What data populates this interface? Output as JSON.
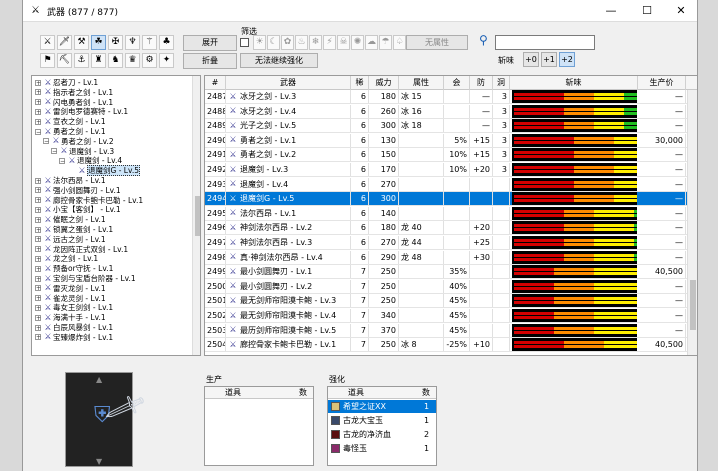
{
  "window": {
    "title": "武器 (877 / 877)",
    "minimize": "—",
    "maximize": "☐",
    "close": "✕"
  },
  "toolbar": {
    "expand_label": "展开",
    "collapse_label": "折叠",
    "filter_label": "筛选",
    "no_attr_label": "无属性",
    "unlimited_label": "无法继续强化",
    "sharp_label": "斩味",
    "sharp_options": [
      "+0",
      "+1",
      "+2"
    ],
    "search_value": "",
    "search_icon": "search-icon"
  },
  "columns": [
    "#",
    "武器",
    "稀",
    "威力",
    "属性",
    "会",
    "防",
    "洞",
    "斩味",
    "生产价"
  ],
  "rows": [
    {
      "id": "2487",
      "name": "冰牙之剑 - Lv.3",
      "rar": "6",
      "atk": "180",
      "attr": "冰 15",
      "aff": "",
      "def": "—",
      "slots": "3",
      "price": "—",
      "bars": [
        10,
        6,
        6,
        8,
        4,
        0
      ]
    },
    {
      "id": "2488",
      "name": "冰牙之剑 - Lv.4",
      "rar": "6",
      "atk": "260",
      "attr": "冰 16",
      "aff": "",
      "def": "—",
      "slots": "3",
      "price": "—",
      "bars": [
        10,
        6,
        6,
        8,
        5,
        0
      ]
    },
    {
      "id": "2489",
      "name": "光子之剑 - Lv.5",
      "rar": "6",
      "atk": "300",
      "attr": "冰 18",
      "aff": "",
      "def": "—",
      "slots": "3",
      "price": "—",
      "bars": [
        10,
        6,
        6,
        8,
        6,
        0
      ]
    },
    {
      "id": "2490",
      "name": "勇者之剑 - Lv.1",
      "rar": "6",
      "atk": "130",
      "attr": "",
      "aff": "5%",
      "def": "+15",
      "slots": "3",
      "price": "30,000",
      "bars": [
        12,
        8,
        10,
        10,
        0,
        0
      ]
    },
    {
      "id": "2491",
      "name": "勇者之剑 - Lv.2",
      "rar": "6",
      "atk": "150",
      "attr": "",
      "aff": "10%",
      "def": "+15",
      "slots": "3",
      "price": "—",
      "bars": [
        12,
        8,
        10,
        12,
        0,
        0
      ]
    },
    {
      "id": "2492",
      "name": "退魔剑 - Lv.3",
      "rar": "6",
      "atk": "170",
      "attr": "",
      "aff": "10%",
      "def": "+20",
      "slots": "3",
      "price": "—",
      "bars": [
        12,
        8,
        10,
        14,
        2,
        0
      ]
    },
    {
      "id": "2493",
      "name": "退魔剑 - Lv.4",
      "rar": "6",
      "atk": "270",
      "attr": "",
      "aff": "",
      "def": "",
      "slots": "",
      "price": "—",
      "bars": [
        12,
        8,
        10,
        14,
        3,
        0
      ]
    },
    {
      "id": "2494",
      "name": "退魔剑G - Lv.5",
      "rar": "6",
      "atk": "300",
      "attr": "",
      "aff": "",
      "def": "",
      "slots": "",
      "price": "—",
      "bars": [
        12,
        8,
        10,
        14,
        4,
        2
      ]
    },
    {
      "id": "2495",
      "name": "法尔西昂 - Lv.1",
      "rar": "6",
      "atk": "140",
      "attr": "",
      "aff": "",
      "def": "",
      "slots": "",
      "price": "—",
      "bars": [
        10,
        6,
        8,
        10,
        0,
        0
      ]
    },
    {
      "id": "2496",
      "name": "神剑法尔西昂 - Lv.2",
      "rar": "6",
      "atk": "180",
      "attr": "龙 40",
      "aff": "",
      "def": "+20",
      "slots": "",
      "price": "—",
      "bars": [
        10,
        6,
        8,
        12,
        2,
        0
      ]
    },
    {
      "id": "2497",
      "name": "神剑法尔西昂 - Lv.3",
      "rar": "6",
      "atk": "270",
      "attr": "龙 44",
      "aff": "",
      "def": "+25",
      "slots": "",
      "price": "—",
      "bars": [
        10,
        6,
        8,
        12,
        3,
        0
      ]
    },
    {
      "id": "2498",
      "name": "真·神剑法尔西昂 - Lv.4",
      "rar": "6",
      "atk": "290",
      "attr": "龙 48",
      "aff": "",
      "def": "+30",
      "slots": "",
      "price": "—",
      "bars": [
        10,
        6,
        8,
        12,
        4,
        2
      ]
    },
    {
      "id": "2499",
      "name": "最小剑圆舞刃 - Lv.1",
      "rar": "7",
      "atk": "250",
      "attr": "",
      "aff": "35%",
      "def": "",
      "slots": "",
      "price": "40,500",
      "bars": [
        8,
        8,
        14,
        6,
        0,
        0
      ]
    },
    {
      "id": "2500",
      "name": "最小剑圆舞刃 - Lv.2",
      "rar": "7",
      "atk": "250",
      "attr": "",
      "aff": "40%",
      "def": "",
      "slots": "",
      "price": "—",
      "bars": [
        8,
        8,
        14,
        8,
        0,
        0
      ]
    },
    {
      "id": "2501",
      "name": "最无剑师帘阳漠卡鲍 - Lv.3",
      "rar": "7",
      "atk": "250",
      "attr": "",
      "aff": "45%",
      "def": "",
      "slots": "",
      "price": "—",
      "bars": [
        8,
        8,
        14,
        10,
        0,
        0
      ]
    },
    {
      "id": "2502",
      "name": "最无剑师帘阳漠卡鲍 - Lv.4",
      "rar": "7",
      "atk": "340",
      "attr": "",
      "aff": "45%",
      "def": "",
      "slots": "",
      "price": "—",
      "bars": [
        8,
        8,
        14,
        10,
        2,
        0
      ]
    },
    {
      "id": "2503",
      "name": "最历剑师帘阳漠卡鲍 - Lv.5",
      "rar": "7",
      "atk": "370",
      "attr": "",
      "aff": "45%",
      "def": "",
      "slots": "",
      "price": "—",
      "bars": [
        8,
        8,
        14,
        10,
        3,
        0
      ]
    },
    {
      "id": "2504",
      "name": "廊控骨家卡鲍卡巴勒 - Lv.1",
      "rar": "7",
      "atk": "250",
      "attr": "冰 8",
      "aff": "-25%",
      "def": "+10",
      "slots": "",
      "price": "40,500",
      "bars": [
        10,
        8,
        12,
        6,
        2,
        0
      ]
    }
  ],
  "tree": [
    {
      "label": "忍者刀 - Lv.1",
      "level": 0,
      "sw": "+"
    },
    {
      "label": "指示者之剑 - Lv.1",
      "level": 0,
      "sw": "+"
    },
    {
      "label": "闪电勇者剑 - Lv.1",
      "level": 0,
      "sw": "+"
    },
    {
      "label": "雷剑电罗德赛特 - Lv.1",
      "level": 0,
      "sw": "+"
    },
    {
      "label": "宣衣之剑 - Lv.1",
      "level": 0,
      "sw": "+"
    },
    {
      "label": "勇者之剑 - Lv.1",
      "level": 0,
      "sw": "−"
    },
    {
      "label": "勇者之剑 - Lv.2",
      "level": 1,
      "sw": "−"
    },
    {
      "label": "退魔剑 - Lv.3",
      "level": 2,
      "sw": "−"
    },
    {
      "label": "退魔剑 - Lv.4",
      "level": 3,
      "sw": "−"
    },
    {
      "label": "退魔剑G - Lv.5",
      "level": 4,
      "sw": "",
      "sel": true
    },
    {
      "label": "法尔西昂 - Lv.1",
      "level": 0,
      "sw": "+"
    },
    {
      "label": "强小剑圆舞刃 - Lv.1",
      "level": 0,
      "sw": "+"
    },
    {
      "label": "廊控骨家卡鲍卡巴勒 - Lv.1",
      "level": 0,
      "sw": "+"
    },
    {
      "label": "小宝【客剑】 - Lv.1",
      "level": 0,
      "sw": "+"
    },
    {
      "label": "催眠之剑 - Lv.1",
      "level": 0,
      "sw": "+"
    },
    {
      "label": "锁翼之蛋剑 - Lv.1",
      "level": 0,
      "sw": "+"
    },
    {
      "label": "远古之剑 - Lv.1",
      "level": 0,
      "sw": "+"
    },
    {
      "label": "龙因阵正式双剑 - Lv.1",
      "level": 0,
      "sw": "+"
    },
    {
      "label": "龙之剑 - Lv.1",
      "level": 0,
      "sw": "+"
    },
    {
      "label": "预备or守抚 - Lv.1",
      "level": 0,
      "sw": "+"
    },
    {
      "label": "宝剑与宝盾台阶器 - Lv.1",
      "level": 0,
      "sw": "+"
    },
    {
      "label": "雷灭龙剑 - Lv.1",
      "level": 0,
      "sw": "+"
    },
    {
      "label": "雀龙灵剑 - Lv.1",
      "level": 0,
      "sw": "+"
    },
    {
      "label": "毒女王剑剑 - Lv.1",
      "level": 0,
      "sw": "+"
    },
    {
      "label": "海满十手 - Lv.1",
      "level": 0,
      "sw": "+"
    },
    {
      "label": "白辰风暴剑 - Lv.1",
      "level": 0,
      "sw": "+"
    },
    {
      "label": "宝臻爆炸剑 - Lv.1",
      "level": 0,
      "sw": "+"
    }
  ],
  "production": {
    "title": "生产",
    "col_item": "道具",
    "col_qty": "数"
  },
  "upgrade": {
    "title": "强化",
    "col_item": "道具",
    "col_qty": "数",
    "items": [
      {
        "name": "希望之证XX",
        "qty": "1",
        "color": "#d9c27a"
      },
      {
        "name": "古龙大宝玉",
        "qty": "1",
        "color": "#3a4a6a"
      },
      {
        "name": "古龙的净济血",
        "qty": "2",
        "color": "#5a1010"
      },
      {
        "name": "毒怪玉",
        "qty": "1",
        "color": "#8a2a6a"
      }
    ]
  },
  "colors": {
    "sharp": [
      "#d40000",
      "#ff8c00",
      "#ffee00",
      "#22c022",
      "#2050e0",
      "#ffffff"
    ],
    "select": "#0078d7"
  }
}
